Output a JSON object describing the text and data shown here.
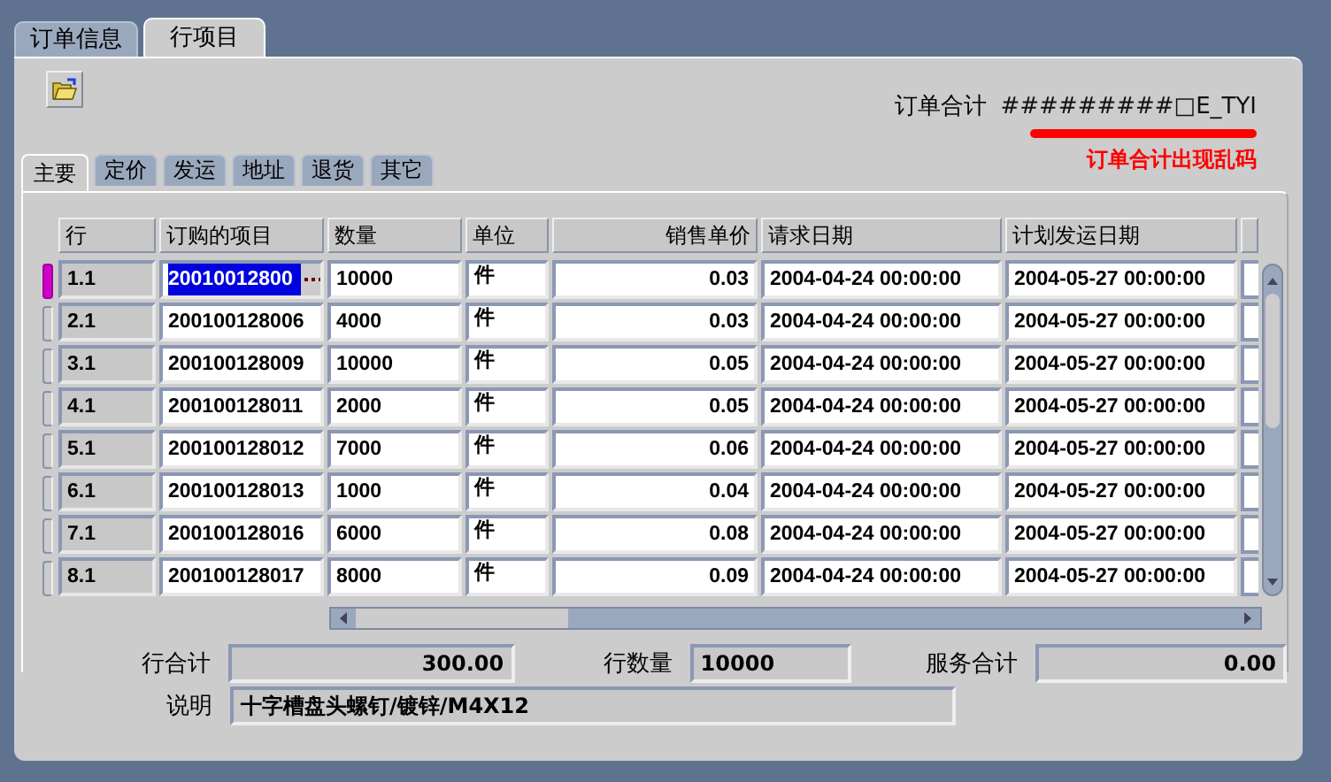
{
  "outer_tabs": [
    {
      "label": "订单信息",
      "selected": false
    },
    {
      "label": "行项目",
      "selected": true
    }
  ],
  "order_total": {
    "label": "订单合计",
    "value": "#########□E_TYI"
  },
  "annotation": "订单合计出现乱码",
  "inner_tabs": [
    {
      "label": "主要",
      "selected": true
    },
    {
      "label": "定价",
      "selected": false
    },
    {
      "label": "发运",
      "selected": false
    },
    {
      "label": "地址",
      "selected": false
    },
    {
      "label": "退货",
      "selected": false
    },
    {
      "label": "其它",
      "selected": false
    }
  ],
  "table": {
    "columns": [
      "行",
      "订购的项目",
      "数量",
      "单位",
      "销售单价",
      "请求日期",
      "计划发运日期"
    ],
    "rows": [
      {
        "selected": true,
        "cells": [
          "1.1",
          "20010012800",
          "10000",
          "件",
          "0.03",
          "2004-04-24 00:00:00",
          "2004-05-27 00:00:00"
        ]
      },
      {
        "selected": false,
        "cells": [
          "2.1",
          "200100128006",
          "4000",
          "件",
          "0.03",
          "2004-04-24 00:00:00",
          "2004-05-27 00:00:00"
        ]
      },
      {
        "selected": false,
        "cells": [
          "3.1",
          "200100128009",
          "10000",
          "件",
          "0.05",
          "2004-04-24 00:00:00",
          "2004-05-27 00:00:00"
        ]
      },
      {
        "selected": false,
        "cells": [
          "4.1",
          "200100128011",
          "2000",
          "件",
          "0.05",
          "2004-04-24 00:00:00",
          "2004-05-27 00:00:00"
        ]
      },
      {
        "selected": false,
        "cells": [
          "5.1",
          "200100128012",
          "7000",
          "件",
          "0.06",
          "2004-04-24 00:00:00",
          "2004-05-27 00:00:00"
        ]
      },
      {
        "selected": false,
        "cells": [
          "6.1",
          "200100128013",
          "1000",
          "件",
          "0.04",
          "2004-04-24 00:00:00",
          "2004-05-27 00:00:00"
        ]
      },
      {
        "selected": false,
        "cells": [
          "7.1",
          "200100128016",
          "6000",
          "件",
          "0.08",
          "2004-04-24 00:00:00",
          "2004-05-27 00:00:00"
        ]
      },
      {
        "selected": false,
        "cells": [
          "8.1",
          "200100128017",
          "8000",
          "件",
          "0.09",
          "2004-04-24 00:00:00",
          "2004-05-27 00:00:00"
        ]
      }
    ]
  },
  "totals": [
    {
      "label": "行合计",
      "value": "300.00"
    },
    {
      "label": "行数量",
      "value": "10000"
    },
    {
      "label": "服务合计",
      "value": "0.00"
    }
  ],
  "description": {
    "label": "说明",
    "value": "十字槽盘头螺钉/镀锌/M4X12"
  }
}
